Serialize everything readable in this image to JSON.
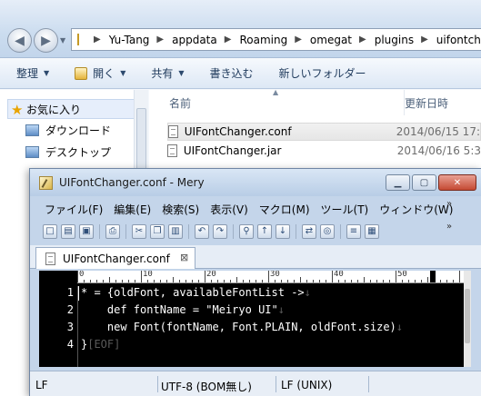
{
  "explorer": {
    "breadcrumb": [
      "Yu-Tang",
      "appdata",
      "Roaming",
      "omegat",
      "plugins",
      "uifontchanger"
    ],
    "commands": {
      "organize": "整理",
      "open": "開く",
      "share": "共有",
      "burn": "書き込む",
      "new_folder": "新しいフォルダー"
    },
    "nav": {
      "favorites": "お気に入り",
      "downloads": "ダウンロード",
      "desktop": "デスクトップ"
    },
    "columns": {
      "name": "名前",
      "date": "更新日時"
    },
    "files": [
      {
        "name": "UIFontChanger.conf",
        "date": "2014/06/15 17:"
      },
      {
        "name": "UIFontChanger.jar",
        "date": "2014/06/16 5:3"
      }
    ]
  },
  "mery": {
    "title": "UIFontChanger.conf - Mery",
    "menu": [
      "ファイル(F)",
      "編集(E)",
      "検索(S)",
      "表示(V)",
      "マクロ(M)",
      "ツール(T)",
      "ウィンドウ(W)"
    ],
    "toolbar_icons": [
      "new-file-icon",
      "open-file-icon",
      "save-icon",
      "print-icon",
      "cut-icon",
      "copy-icon",
      "paste-icon",
      "undo-icon",
      "redo-icon",
      "find-icon",
      "find-prev-icon",
      "find-next-icon",
      "replace-icon",
      "zoom-icon",
      "wrap-icon",
      "view-icon"
    ],
    "tab": "UIFontChanger.conf",
    "ruler_labels": [
      "0",
      "10",
      "20",
      "30",
      "40",
      "50"
    ],
    "lines": [
      {
        "num": "1",
        "text": "* = {oldFont, availableFontList ->"
      },
      {
        "num": "2",
        "text": "    def fontName = \"Meiryo UI\""
      },
      {
        "num": "3",
        "text": "    new Font(fontName, Font.PLAIN, oldFont.size)"
      },
      {
        "num": "4",
        "text": "}"
      }
    ],
    "eol_mark": "↓",
    "eof_mark": "[EOF]",
    "status": {
      "left": "LF",
      "encoding": "UTF-8 (BOM無し)",
      "newline": "LF (UNIX)"
    }
  }
}
